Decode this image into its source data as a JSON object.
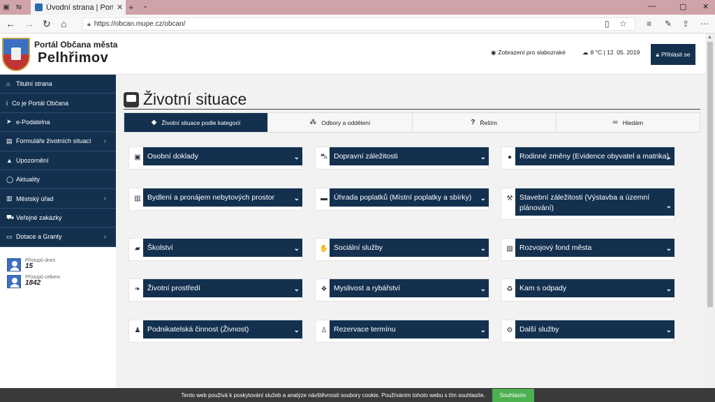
{
  "browser": {
    "tab_title": "Úvodní strana | Portal O",
    "url": "https://obcan.mupe.cz/obcan/"
  },
  "header": {
    "portal_title": "Portál Občana města",
    "city_name": "Pelhřimov",
    "low_vision": "Zobrazení pro slabozraké",
    "weather": "8 °C | 12. 05. 2019",
    "login": "Přihlásit se"
  },
  "sidebar": {
    "items": [
      {
        "label": "Titulní strana",
        "icon": "home-icon",
        "submenu": false
      },
      {
        "label": "Co je Portál Občana",
        "icon": "info-icon",
        "submenu": false
      },
      {
        "label": "e-Podatelna",
        "icon": "paper-plane-icon",
        "submenu": false
      },
      {
        "label": "Formuláře životních situací",
        "icon": "form-icon",
        "submenu": true
      },
      {
        "label": "Upozornění",
        "icon": "warning-icon",
        "submenu": false
      },
      {
        "label": "Aktuality",
        "icon": "comment-icon",
        "submenu": false
      },
      {
        "label": "Městský úřad",
        "icon": "building-icon",
        "submenu": true
      },
      {
        "label": "Veřejné zakázky",
        "icon": "cart-icon",
        "submenu": false
      },
      {
        "label": "Dotace a Granty",
        "icon": "money-icon",
        "submenu": true
      }
    ],
    "stats": {
      "today_label": "Přístupů dnes",
      "today_value": "15",
      "total_label": "Přístupů celkem",
      "total_value": "1842"
    }
  },
  "main": {
    "title": "Životní situace",
    "tabs": [
      {
        "label": "Životní situace podle kategorií",
        "icon": "tags-icon",
        "active": true
      },
      {
        "label": "Odbory a oddělení",
        "icon": "sitemap-icon",
        "active": false
      },
      {
        "label": "Řeším",
        "icon": "question-icon",
        "active": false
      },
      {
        "label": "Hledám",
        "icon": "binoculars-icon",
        "active": false
      }
    ],
    "categories": [
      {
        "label": "Osobní doklady",
        "icon": "id-card-icon"
      },
      {
        "label": "Dopravní záležitosti",
        "icon": "car-icon"
      },
      {
        "label": "Rodinné změny (Evidence obyvatel a matrika)",
        "icon": "users-icon"
      },
      {
        "label": "Bydlení a pronájem nebytových prostor",
        "icon": "building-icon"
      },
      {
        "label": "Úhrada poplatků (Místní poplatky a sbírky)",
        "icon": "money-icon"
      },
      {
        "label": "Stavební záležitosti (Výstavba a územní plánování)",
        "icon": "hammer-icon"
      },
      {
        "label": "Školství",
        "icon": "graduation-cap-icon"
      },
      {
        "label": "Sociální služby",
        "icon": "handshake-icon"
      },
      {
        "label": "Rozvojový fond města",
        "icon": "clipboard-icon"
      },
      {
        "label": "Životní prostředí",
        "icon": "leaf-icon"
      },
      {
        "label": "Myslivost a rybářství",
        "icon": "paw-icon"
      },
      {
        "label": "Kam s odpady",
        "icon": "recycle-icon"
      },
      {
        "label": "Podnikatelská činnost (Živnost)",
        "icon": "user-tie-icon"
      },
      {
        "label": "Rezervace termínu",
        "icon": "user-clock-icon"
      },
      {
        "label": "Další služby",
        "icon": "cogs-icon"
      }
    ]
  },
  "cookie": {
    "text": "Tento web používá k poskytování služeb a analýze návštěvnosti soubory cookie. Používáním tohoto webu s tím souhlasíte.",
    "button": "Souhlasím"
  },
  "colors": {
    "primary": "#13304f",
    "accent_green": "#4caf50",
    "tabbar": "#cfa3a8"
  }
}
